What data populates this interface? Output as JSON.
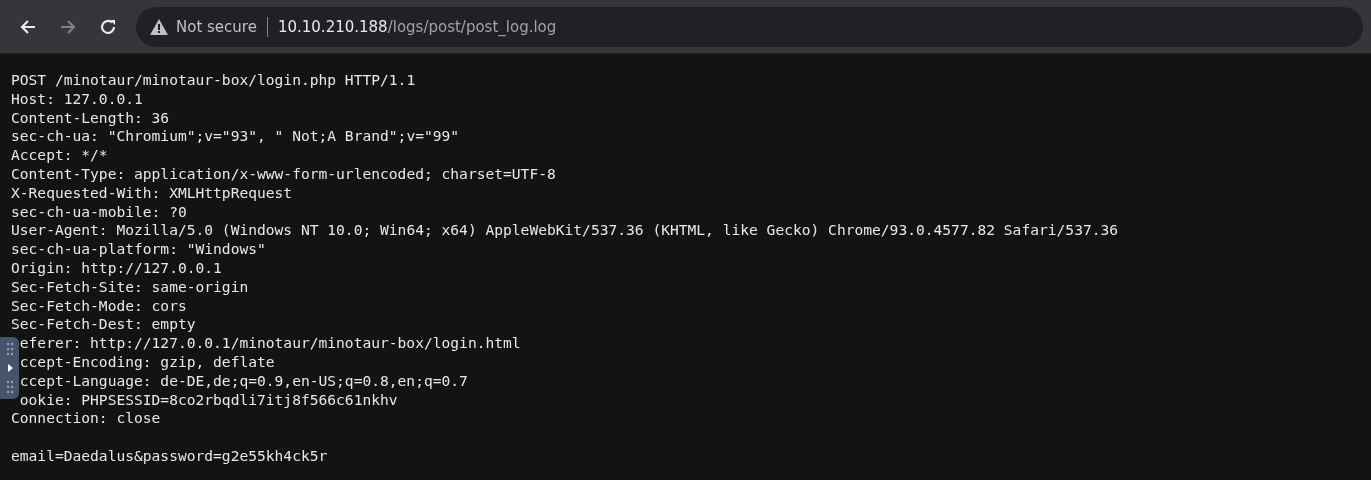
{
  "toolbar": {
    "back_enabled": true,
    "forward_enabled": false,
    "security_label": "Not secure",
    "url_host": "10.10.210.188",
    "url_path": "/logs/post/post_log.log"
  },
  "log_lines": [
    {
      "text": "POST /minotaur/minotaur-box/login.php HTTP/1.1",
      "covered": false
    },
    {
      "text": "Host: 127.0.0.1",
      "covered": false
    },
    {
      "text": "Content-Length: 36",
      "covered": false
    },
    {
      "text": "sec-ch-ua: \"Chromium\";v=\"93\", \" Not;A Brand\";v=\"99\"",
      "covered": false
    },
    {
      "text": "Accept: */*",
      "covered": false
    },
    {
      "text": "Content-Type: application/x-www-form-urlencoded; charset=UTF-8",
      "covered": false
    },
    {
      "text": "X-Requested-With: XMLHttpRequest",
      "covered": false
    },
    {
      "text": "sec-ch-ua-mobile: ?0",
      "covered": false
    },
    {
      "text": "User-Agent: Mozilla/5.0 (Windows NT 10.0; Win64; x64) AppleWebKit/537.36 (KHTML, like Gecko) Chrome/93.0.4577.82 Safari/537.36",
      "covered": false
    },
    {
      "text": "sec-ch-ua-platform: \"Windows\"",
      "covered": false
    },
    {
      "text": "Origin: http://127.0.0.1",
      "covered": false
    },
    {
      "text": "Sec-Fetch-Site: same-origin",
      "covered": false
    },
    {
      "text": "Sec-Fetch-Mode: cors",
      "covered": false
    },
    {
      "text": "Sec-Fetch-Dest: empty",
      "covered": false
    },
    {
      "text": "eferer: http://127.0.0.1/minotaur/minotaur-box/login.html",
      "covered": true
    },
    {
      "text": "ccept-Encoding: gzip, deflate",
      "covered": true
    },
    {
      "text": "ccept-Language: de-DE,de;q=0.9,en-US;q=0.8,en;q=0.7",
      "covered": true
    },
    {
      "text": "ookie: PHPSESSID=8co2rbqdli7itj8f566c61nkhv",
      "covered": true
    },
    {
      "text": "Connection: close",
      "covered": false
    }
  ],
  "request_body": "email=Daedalus&password=g2e55kh4ck5r"
}
